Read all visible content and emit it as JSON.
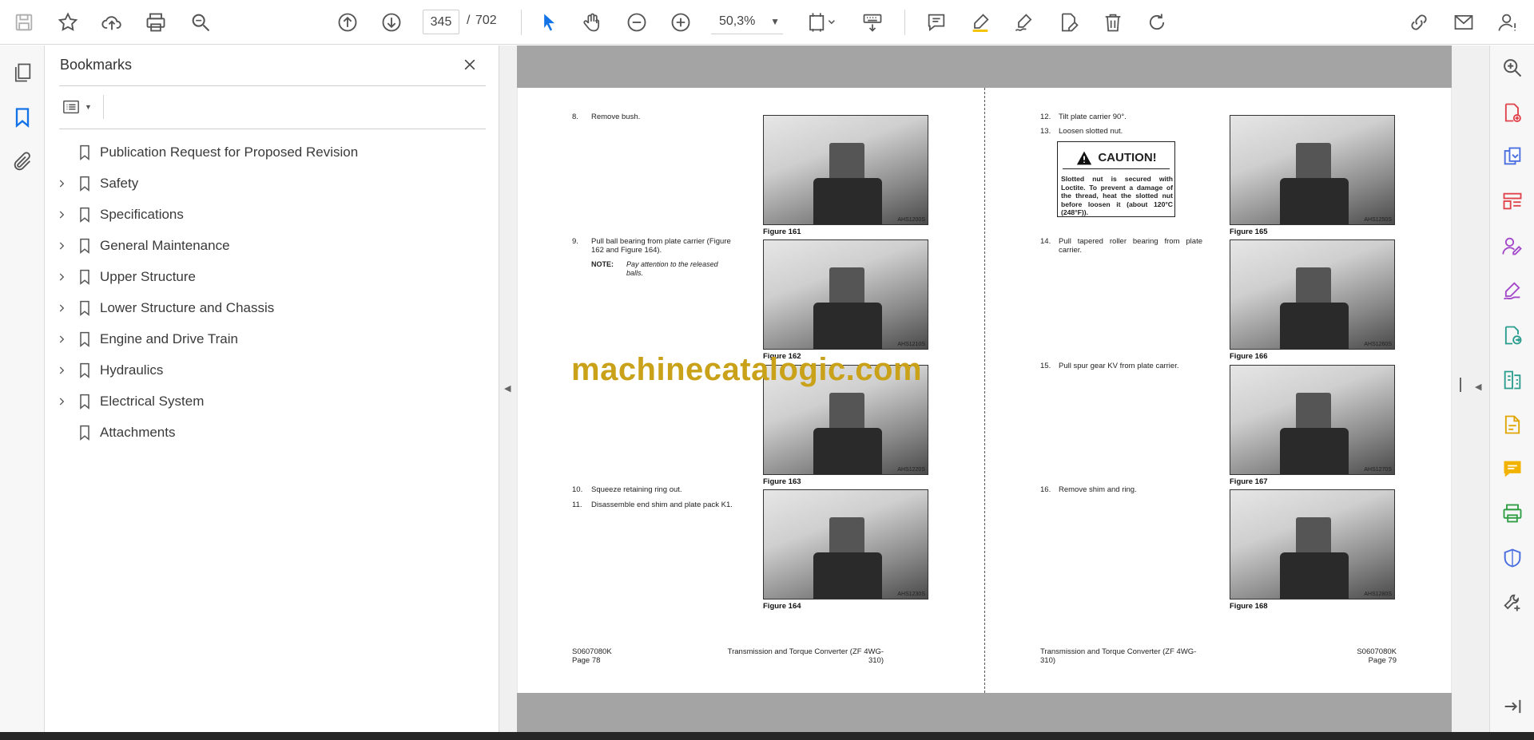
{
  "toolbar": {
    "page_current": "345",
    "page_separator": "/",
    "page_total": "702",
    "zoom": "50,3%",
    "icons": [
      "save-icon",
      "star-icon",
      "upload-icon",
      "print-icon",
      "find-icon",
      "page-up-icon",
      "page-down-icon",
      "select-cursor-icon",
      "hand-icon",
      "zoom-out-icon",
      "zoom-in-icon",
      "fit-page-icon",
      "keyboard-icon",
      "comment-icon",
      "highlight-icon",
      "sign-icon",
      "edit-pdf-icon",
      "delete-icon",
      "rotate-icon",
      "share-link-icon",
      "mail-icon",
      "account-icon"
    ]
  },
  "bookmarks": {
    "title": "Bookmarks",
    "items": [
      {
        "label": "Publication Request for Proposed Revision",
        "expandable": false
      },
      {
        "label": "Safety",
        "expandable": true
      },
      {
        "label": "Specifications",
        "expandable": true
      },
      {
        "label": "General Maintenance",
        "expandable": true
      },
      {
        "label": "Upper Structure",
        "expandable": true
      },
      {
        "label": "Lower Structure and Chassis",
        "expandable": true
      },
      {
        "label": "Engine and Drive Train",
        "expandable": true
      },
      {
        "label": "Hydraulics",
        "expandable": true
      },
      {
        "label": "Electrical System",
        "expandable": true
      },
      {
        "label": "Attachments",
        "expandable": false
      }
    ]
  },
  "document": {
    "left_page": {
      "steps": [
        {
          "num": "8.",
          "text": "Remove bush."
        },
        {
          "num": "9.",
          "text": "Pull ball bearing from plate carrier (Figure 162 and Figure 164)."
        },
        {
          "num": "10.",
          "text": "Squeeze retaining ring out."
        },
        {
          "num": "11.",
          "text": "Disassemble end shim and plate pack K1."
        }
      ],
      "note_label": "NOTE:",
      "note_text": "Pay attention to the released balls.",
      "figures": [
        {
          "caption": "Figure 161",
          "code": "AHS1200S"
        },
        {
          "caption": "Figure 162",
          "code": "AHS1210S"
        },
        {
          "caption": "Figure 163",
          "code": "AHS1220S"
        },
        {
          "caption": "Figure 164",
          "code": "AHS1230S"
        }
      ],
      "footer_code": "S0607080K",
      "footer_page": "Page 78",
      "footer_title_1": "Transmission and Torque Converter (ZF 4WG-",
      "footer_title_2": "310)"
    },
    "right_page": {
      "steps": [
        {
          "num": "12.",
          "text": "Tilt plate carrier 90°."
        },
        {
          "num": "13.",
          "text": "Loosen slotted nut."
        },
        {
          "num": "14.",
          "text": "Pull tapered roller bearing from plate carrier."
        },
        {
          "num": "15.",
          "text": "Pull spur gear KV from plate carrier."
        },
        {
          "num": "16.",
          "text": "Remove shim and ring."
        }
      ],
      "caution_title": "CAUTION!",
      "caution_text": "Slotted nut is secured with Loctite. To prevent a damage of the thread, heat the slotted nut before loosen it (about 120°C (248°F)).",
      "figures": [
        {
          "caption": "Figure 165",
          "code": "AHS1250S"
        },
        {
          "caption": "Figure 166",
          "code": "AHS1260S"
        },
        {
          "caption": "Figure 167",
          "code": "AHS1270S"
        },
        {
          "caption": "Figure 168",
          "code": "AHS1280S"
        }
      ],
      "footer_code": "S0607080K",
      "footer_page": "Page 79",
      "footer_title_1": "Transmission and Torque Converter (ZF 4WG-",
      "footer_title_2": "310)"
    },
    "watermark": "machinecatalogic.com"
  },
  "colors": {
    "accent_blue": "#1473e6",
    "watermark": "#c9a21a",
    "gray_strip": "#a4a4a4"
  }
}
